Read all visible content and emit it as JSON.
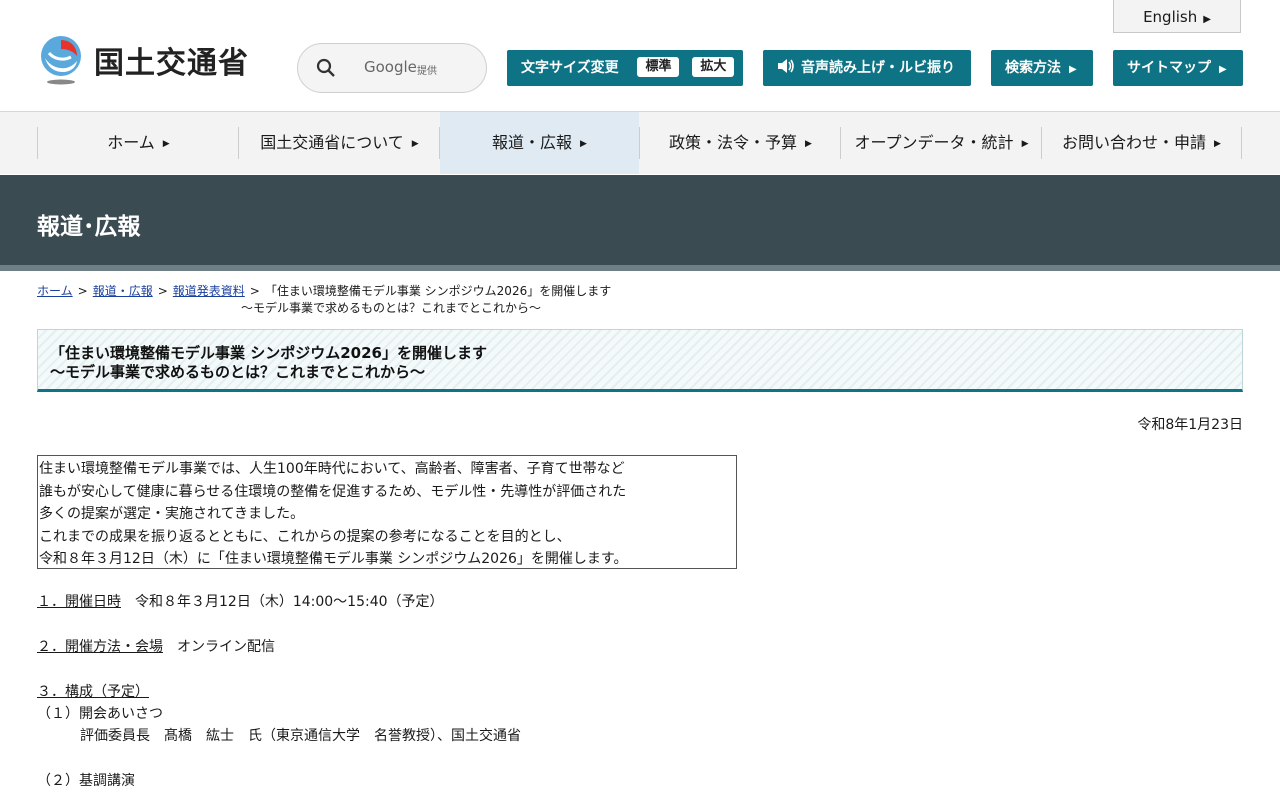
{
  "header": {
    "logo_text": "国土交通省",
    "english_label": "English",
    "search": {
      "brand": "Google",
      "provided": "提供"
    },
    "font_size_label": "文字サイズ変更",
    "font_standard": "標準",
    "font_large": "拡大",
    "speech_label": "音声読み上げ・ルビ振り",
    "search_method_label": "検索方法",
    "sitemap_label": "サイトマップ"
  },
  "nav": {
    "items": [
      {
        "label": "ホーム"
      },
      {
        "label": "国土交通省について"
      },
      {
        "label": "報道・広報"
      },
      {
        "label": "政策・法令・予算"
      },
      {
        "label": "オープンデータ・統計"
      },
      {
        "label": "お問い合わせ・申請"
      }
    ],
    "active_index": 2
  },
  "banner": {
    "title": "報道･広報"
  },
  "breadcrumb": {
    "home": "ホーム",
    "press": "報道・広報",
    "releases": "報道発表資料",
    "current_line1": "「住まい環境整備モデル事業 シンポジウム2026」を開催します",
    "current_line2": "～モデル事業で求めるものとは？これまでとこれから～"
  },
  "article": {
    "title_line1": "「住まい環境整備モデル事業 シンポジウム2026」を開催します",
    "title_line2": "～モデル事業で求めるものとは？これまでとこれから～",
    "date": "令和8年1月23日",
    "intro": [
      "住まい環境整備モデル事業では、人生100年時代において、高齢者、障害者、子育て世帯など",
      "誰もが安心して健康に暮らせる住環境の整備を促進するため、モデル性・先導性が評価された",
      "多くの提案が選定・実施されてきました。",
      "これまでの成果を振り返るとともに、これからの提案の参考になることを目的とし、",
      "令和８年３月12日（木）に「住まい環境整備モデル事業 シンポジウム2026」を開催します。"
    ],
    "s1_head": "１．開催日時",
    "s1_body": "令和８年３月12日（木）14:00～15:40（予定）",
    "s2_head": "２．開催方法・会場",
    "s2_body": "オンライン配信",
    "s3_head": "３．構成（予定）",
    "s3_i1": "（１）開会あいさつ",
    "s3_i1_body": "評価委員長　髙橋　紘士　氏（東京通信大学　名誉教授）、国土交通省",
    "s3_i2": "（２）基調講演"
  },
  "colors": {
    "accent": "#0e7384",
    "banner": "#3b4b52",
    "nav_active": "#dfeaf3"
  }
}
